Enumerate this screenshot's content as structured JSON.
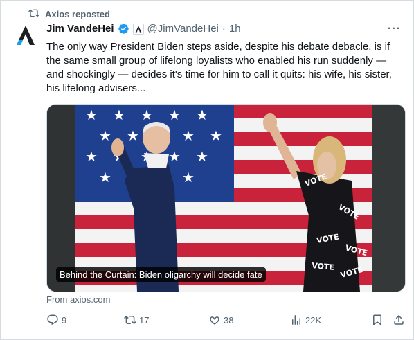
{
  "repost": {
    "label": "Axios reposted",
    "icon": "repost-icon"
  },
  "author": {
    "avatar": "axios-logo",
    "name": "Jim VandeHei",
    "handle": "@JimVandeHei",
    "separator": "·",
    "time": "1h",
    "verified_icon": "verified-badge-icon",
    "affiliate_icon": "axios-affiliate-icon"
  },
  "more_label": "···",
  "tweet_text": "The only way President Biden steps aside, despite his debate debacle, is if the same small group of lifelong loyalists who enabled his run suddenly — and shockingly — decides it's time for him to call it quits: his wife, his sister, his lifelong advisers...",
  "media": {
    "caption": "Behind the Curtain: Biden oligarchy will decide fate",
    "dress_text": "VOTE"
  },
  "link_source": "From axios.com",
  "actions": {
    "replies": "9",
    "reposts": "17",
    "likes": "38",
    "views": "22K"
  },
  "colors": {
    "accent": "#1d9bf0",
    "muted": "#536471",
    "text": "#0f1419"
  }
}
